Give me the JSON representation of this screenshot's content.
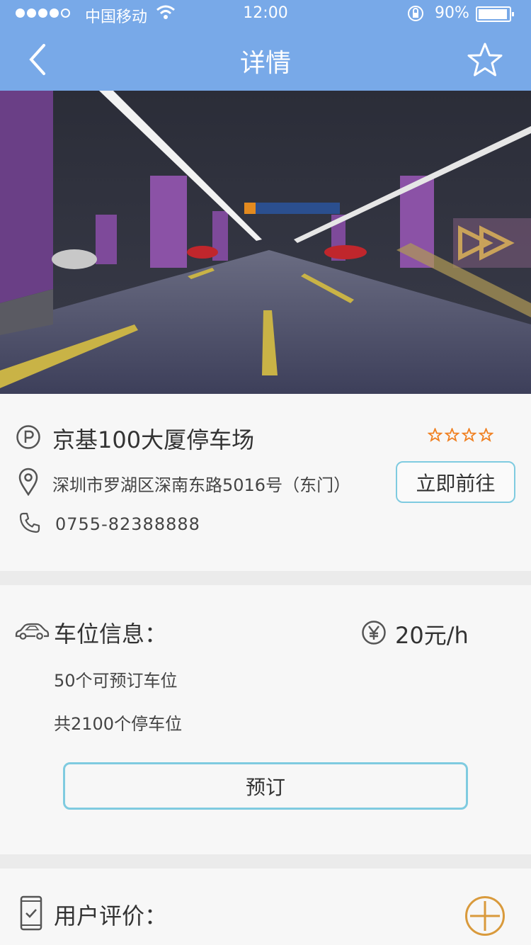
{
  "status_bar": {
    "carrier": "中国移动",
    "time": "12:00",
    "battery_pct": "90%",
    "signal_bars_filled": 4,
    "signal_bars_total": 5,
    "battery_level": 0.9
  },
  "nav": {
    "title": "详情",
    "back_icon": "chevron-left-icon",
    "favorite_icon": "star-outline-icon"
  },
  "lot": {
    "name": "京基100大厦停车场",
    "rating_stars": 4,
    "address": "深圳市罗湖区深南东路5016号（东门）",
    "go_label": "立即前往",
    "phone": "0755-82388888"
  },
  "spots": {
    "title": "车位信息：",
    "price": "20元/h",
    "reservable": "50个可预订车位",
    "total": "共2100个停车位",
    "book_label": "预订"
  },
  "reviews": {
    "title": "用户评价："
  },
  "colors": {
    "accent": "#78a9e8",
    "button_border": "#7fcbe0",
    "star": "#f07f1f",
    "add": "#d99a3c"
  }
}
